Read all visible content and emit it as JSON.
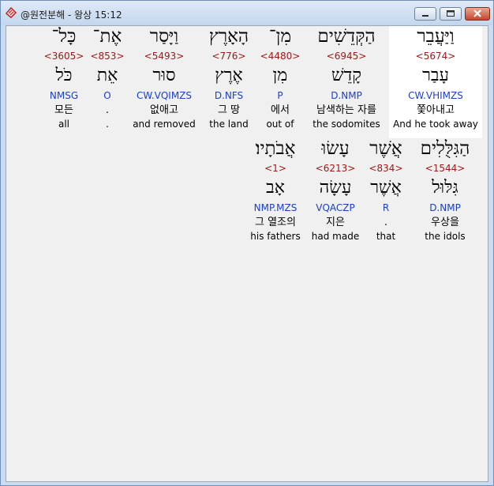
{
  "window": {
    "title": "@원전분해 - 왕상 15:12",
    "app_icon": "bible-app-icon",
    "buttons": [
      "minimize-icon",
      "maximize-icon",
      "close-icon"
    ]
  },
  "colors": {
    "strong_number": "#a01818",
    "morphology": "#1a3fc8",
    "highlight_background": "#ffffff"
  },
  "words": [
    {
      "hebrew": "וַיַּעֲבֵר",
      "strong": "<5674>",
      "lexeme": "עָבַר",
      "morph": "CW.VHIMZS",
      "korean": "쫓아내고",
      "english": "And he took away"
    },
    {
      "hebrew": "הַקְּדֵשִׁים",
      "strong": "<6945>",
      "lexeme": "קָדֵשׁ",
      "morph": "D.NMP",
      "korean": "남색하는 자를",
      "english": "the sodomites"
    },
    {
      "hebrew": "מִן־",
      "strong": "<4480>",
      "lexeme": "מִן",
      "morph": "P",
      "korean": "에서",
      "english": "out of"
    },
    {
      "hebrew": "הָאָרֶץ",
      "strong": "<776>",
      "lexeme": "אֶרֶץ",
      "morph": "D.NFS",
      "korean": "그 땅",
      "english": "the land"
    },
    {
      "hebrew": "וַיָּסַר",
      "strong": "<5493>",
      "lexeme": "סוּר",
      "morph": "CW.VQIMZS",
      "korean": "없애고",
      "english": "and removed"
    },
    {
      "hebrew": "אֶת־",
      "strong": "<853>",
      "lexeme": "אֵת",
      "morph": "O",
      "korean": ".",
      "english": "."
    },
    {
      "hebrew": "כָּל־",
      "strong": "<3605>",
      "lexeme": "כֹּל",
      "morph": "NMSG",
      "korean": "모든",
      "english": "all"
    },
    {
      "hebrew": "הַגִּלֻּלִים",
      "strong": "<1544>",
      "lexeme": "גִּלּוּל",
      "morph": "D.NMP",
      "korean": "우상을",
      "english": "the idols"
    },
    {
      "hebrew": "אֲשֶׁר",
      "strong": "<834>",
      "lexeme": "אֲשֶׁר",
      "morph": "R",
      "korean": ".",
      "english": "that"
    },
    {
      "hebrew": "עָשׂוּ",
      "strong": "<6213>",
      "lexeme": "עָשָׂה",
      "morph": "VQACZP",
      "korean": "지은",
      "english": "had made"
    },
    {
      "hebrew": "אֲבֹתָיו׃",
      "strong": "<1>",
      "lexeme": "אָב",
      "morph": "NMP.MZS",
      "korean": "그 열조의",
      "english": "his fathers"
    }
  ]
}
